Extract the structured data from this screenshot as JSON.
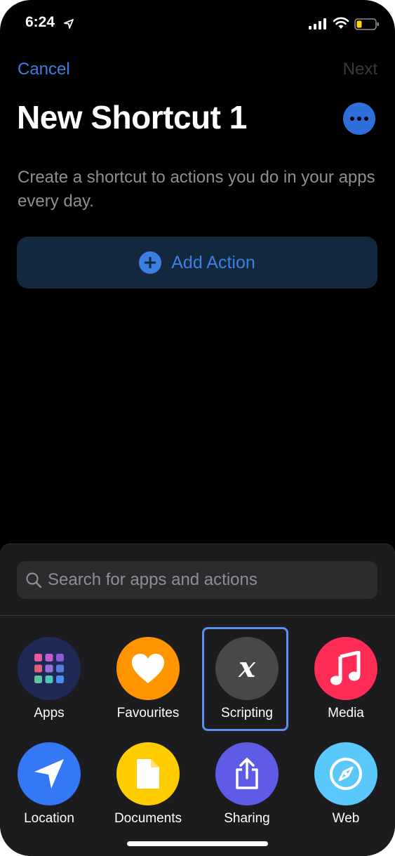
{
  "status": {
    "time": "6:24"
  },
  "nav": {
    "cancel": "Cancel",
    "next": "Next"
  },
  "title": "New Shortcut 1",
  "description": "Create a shortcut to actions you do in your apps every day.",
  "add_action": {
    "label": "Add Action"
  },
  "search": {
    "placeholder": "Search for apps and actions"
  },
  "categories": [
    {
      "label": "Apps",
      "icon": "apps-grid-icon",
      "color": "#1e2a55"
    },
    {
      "label": "Favourites",
      "icon": "heart-icon",
      "color": "#ff9500"
    },
    {
      "label": "Scripting",
      "icon": "variable-x-icon",
      "color": "#48484a",
      "selected": true
    },
    {
      "label": "Media",
      "icon": "music-note-icon",
      "color": "#ff2d55"
    },
    {
      "label": "Location",
      "icon": "location-arrow-icon",
      "color": "#3478f6"
    },
    {
      "label": "Documents",
      "icon": "document-icon",
      "color": "#ffcc00"
    },
    {
      "label": "Sharing",
      "icon": "share-icon",
      "color": "#5e5ce6"
    },
    {
      "label": "Web",
      "icon": "compass-icon",
      "color": "#5ac8fa"
    }
  ],
  "colors": {
    "accent": "#3d7fe0",
    "background": "#000000",
    "sheet": "#1c1c1e"
  }
}
